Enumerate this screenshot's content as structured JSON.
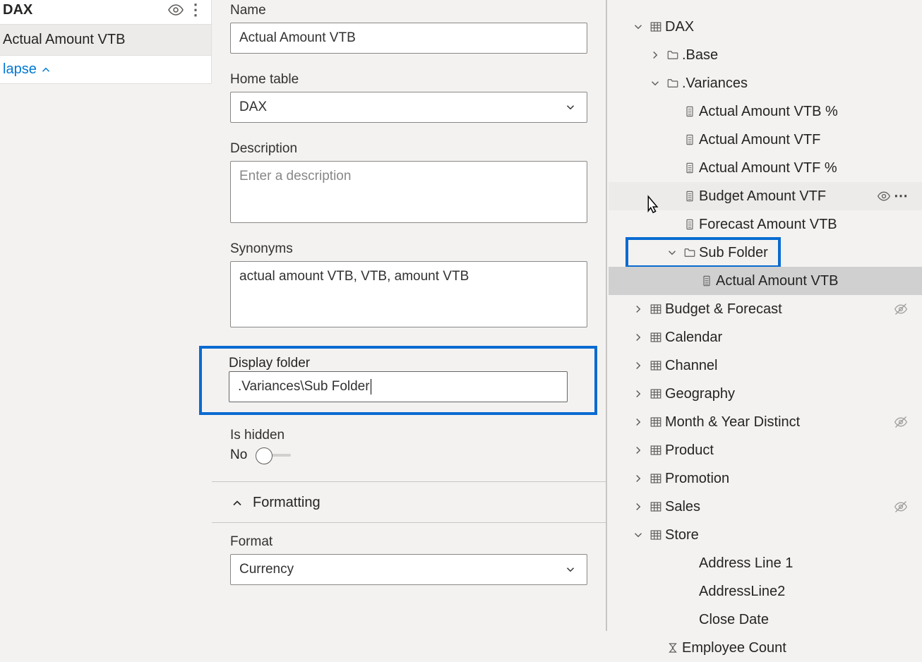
{
  "left": {
    "title": "DAX",
    "item": "Actual Amount VTB",
    "collapse": "lapse"
  },
  "form": {
    "name_label": "Name",
    "name_value": "Actual Amount VTB",
    "home_label": "Home table",
    "home_value": "DAX",
    "desc_label": "Description",
    "desc_placeholder": "Enter a description",
    "syn_label": "Synonyms",
    "syn_value": "actual amount VTB, VTB, amount VTB",
    "folder_label": "Display folder",
    "folder_value": ".Variances\\Sub Folder",
    "hidden_label": "Is hidden",
    "hidden_value": "No",
    "formatting_label": "Formatting",
    "format_label": "Format",
    "format_value": "Currency"
  },
  "tree": {
    "dax": "DAX",
    "base": ".Base",
    "variances": ".Variances",
    "m_vtbp": "Actual Amount VTB %",
    "m_vtf": "Actual Amount VTF",
    "m_vtfp": "Actual Amount VTF %",
    "m_budget_vtf": "Budget Amount VTF",
    "m_forecast_vtb": "Forecast Amount VTB",
    "subfolder": "Sub Folder",
    "m_actual_vtb": "Actual Amount VTB",
    "t_budget": "Budget & Forecast",
    "t_calendar": "Calendar",
    "t_channel": "Channel",
    "t_geo": "Geography",
    "t_my": "Month & Year Distinct",
    "t_product": "Product",
    "t_promo": "Promotion",
    "t_sales": "Sales",
    "t_store": "Store",
    "c_addr1": "Address Line 1",
    "c_addr2": "AddressLine2",
    "c_close": "Close Date",
    "c_emp": "Employee Count"
  }
}
